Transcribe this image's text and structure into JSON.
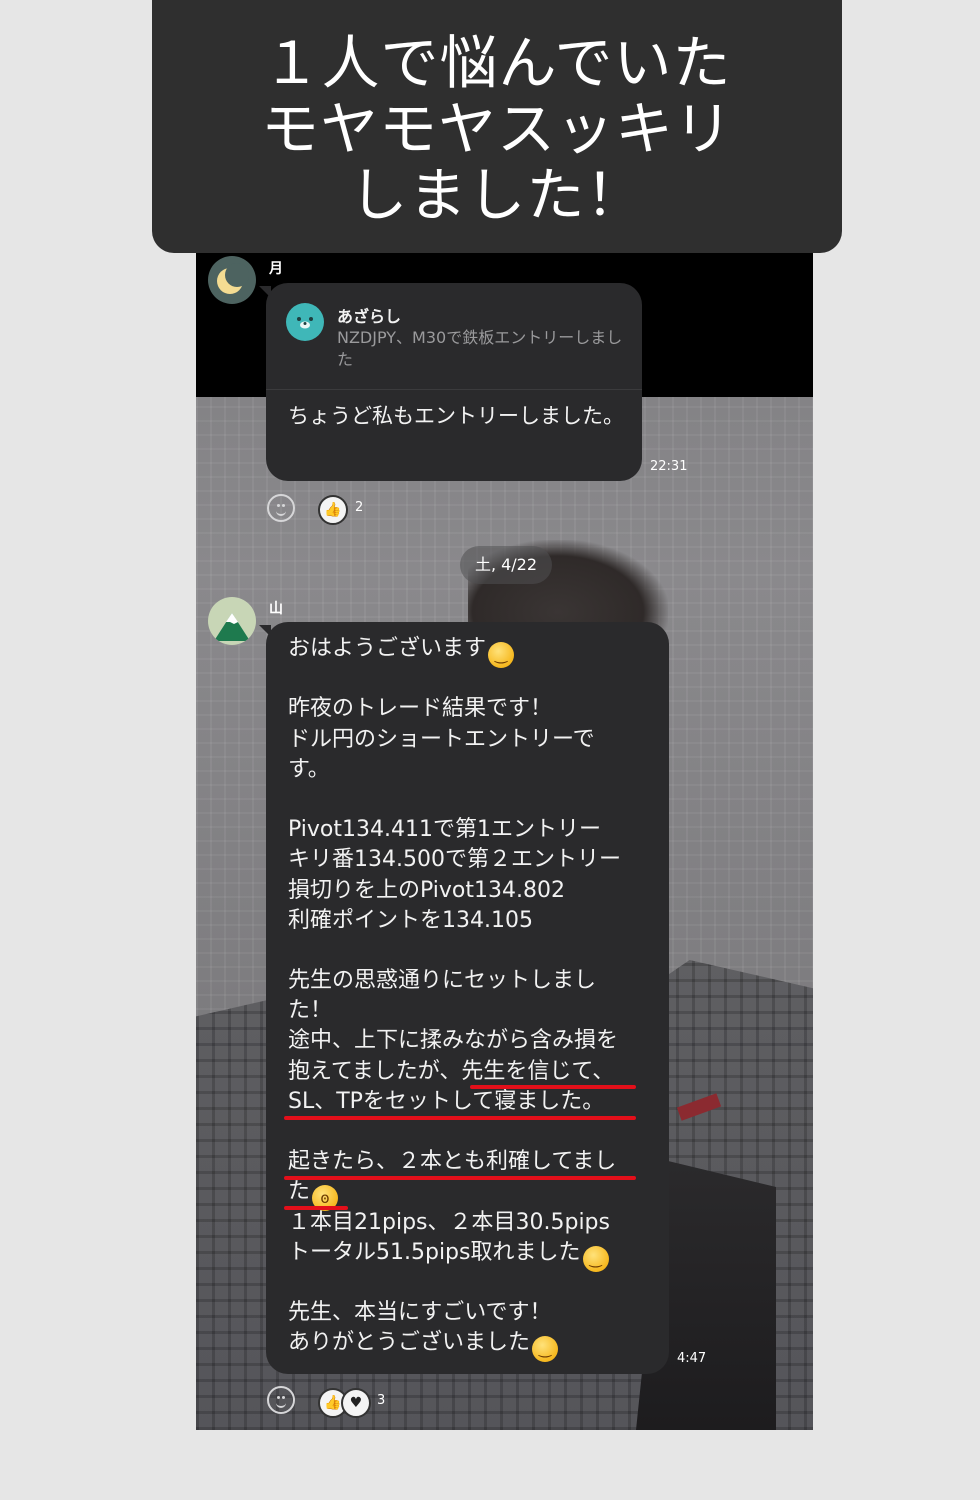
{
  "headline": {
    "lines": [
      "１人で悩んでいた",
      "モヤモヤスッキリ",
      "しました！"
    ]
  },
  "chat": {
    "message1": {
      "sender": "月",
      "quote": {
        "name": "あざらし",
        "text": "NZDJPY、M30で鉄板エントリーしました"
      },
      "text": "ちょうど私もエントリーしました。",
      "time": "22:31",
      "reaction_count": "2"
    },
    "date_separator": "土, 4/22",
    "message2": {
      "sender": "山",
      "lines": [
        "おはようございます",
        "",
        "昨夜のトレード結果です！",
        "ドル円のショートエントリーで",
        "す。",
        "",
        "Pivot134.411で第1エントリー",
        "キリ番134.500で第２エントリー",
        "損切りを上のPivot134.802",
        "利確ポイントを134.105",
        "",
        "先生の思惑通りにセットしまし",
        "た！",
        "途中、上下に揉みながら含み損を",
        "抱えてましたが、先生を信じて、",
        "SL、TPをセットして寝ました。",
        "",
        "起きたら、２本とも利確してまし",
        "た",
        "１本目21pips、２本目30.5pips",
        "トータル51.5pips取れました",
        "",
        "先生、本当にすごいです！",
        "ありがとうございました"
      ],
      "time": "4:47",
      "reaction_count": "3"
    }
  },
  "colors": {
    "headline_bg": "#2f2f2f",
    "bubble_bg": "#2a2a2c",
    "underline": "#e30f1a",
    "quote_avatar": "#3fb7b8"
  }
}
